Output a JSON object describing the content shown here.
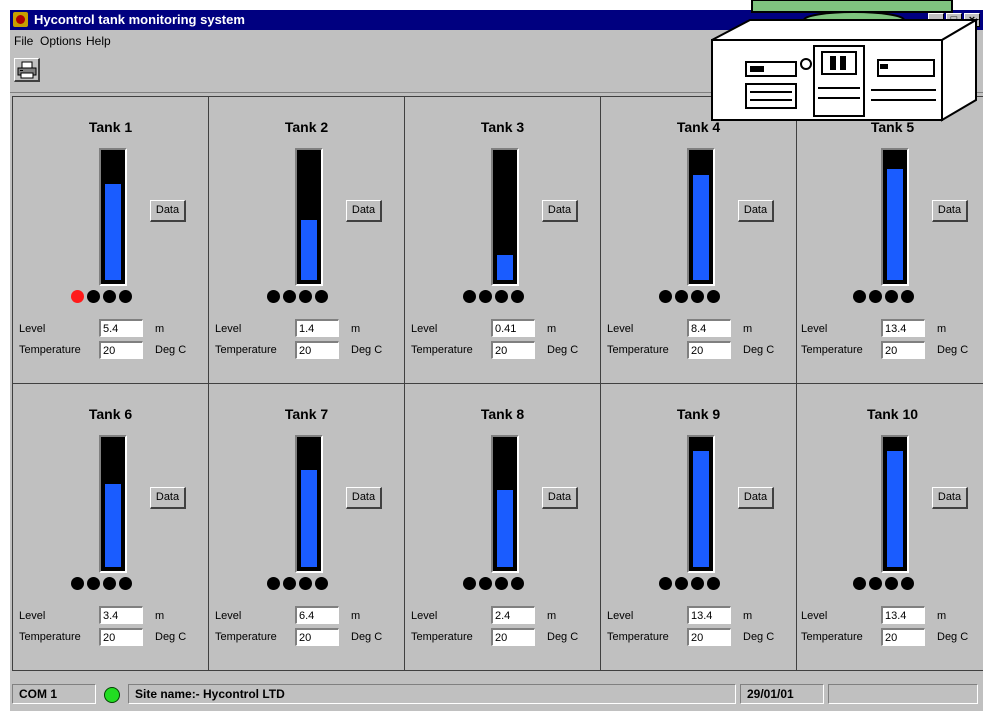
{
  "window": {
    "title": "Hycontrol tank monitoring system",
    "buttons": [
      "_",
      "□",
      "×"
    ]
  },
  "menu": [
    "File",
    "Options",
    "Help"
  ],
  "toolbar": {
    "print_icon": "printer-icon"
  },
  "labels": {
    "level": "Level",
    "temperature": "Temperature",
    "level_unit": "m",
    "temp_unit": "Deg C",
    "data_button": "Data"
  },
  "tanks": [
    {
      "name": "Tank 1",
      "level": "5.4",
      "temperature": "20",
      "fill": 0.76,
      "alarm_led": true
    },
    {
      "name": "Tank 2",
      "level": "1.4",
      "temperature": "20",
      "fill": 0.48,
      "alarm_led": false
    },
    {
      "name": "Tank 3",
      "level": "0.41",
      "temperature": "20",
      "fill": 0.2,
      "alarm_led": false
    },
    {
      "name": "Tank 4",
      "level": "8.4",
      "temperature": "20",
      "fill": 0.83,
      "alarm_led": false
    },
    {
      "name": "Tank 5",
      "level": "13.4",
      "temperature": "20",
      "fill": 0.88,
      "alarm_led": false
    },
    {
      "name": "Tank 6",
      "level": "3.4",
      "temperature": "20",
      "fill": 0.66,
      "alarm_led": false
    },
    {
      "name": "Tank 7",
      "level": "6.4",
      "temperature": "20",
      "fill": 0.77,
      "alarm_led": false
    },
    {
      "name": "Tank 8",
      "level": "2.4",
      "temperature": "20",
      "fill": 0.61,
      "alarm_led": false
    },
    {
      "name": "Tank 9",
      "level": "13.4",
      "temperature": "20",
      "fill": 0.92,
      "alarm_led": false
    },
    {
      "name": "Tank 10",
      "level": "13.4",
      "temperature": "20",
      "fill": 0.92,
      "alarm_led": false
    }
  ],
  "status": {
    "port": "COM 1",
    "site": "Site name:- Hycontrol LTD",
    "date": "29/01/01"
  },
  "colors": {
    "fill": "#1a5cff",
    "alarm": "#ff1a1a",
    "ok": "#22dd22"
  }
}
